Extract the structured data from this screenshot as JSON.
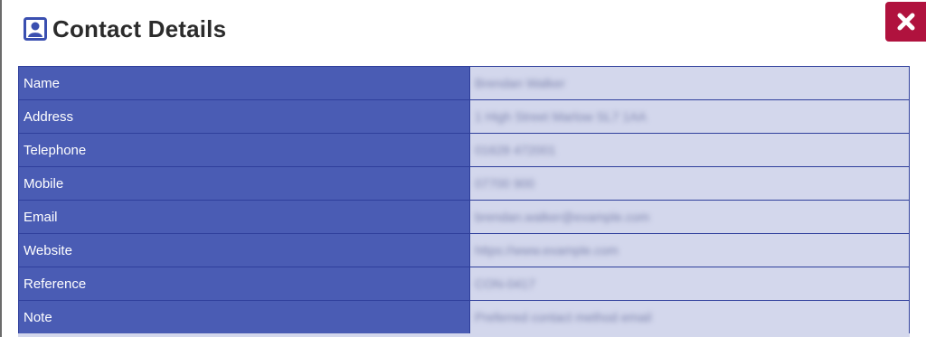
{
  "dialog": {
    "title": "Contact Details",
    "icon": "contact-card-icon",
    "close_icon": "close-icon",
    "accent_color": "#b0123e",
    "label_bg": "#4a5cb4",
    "value_bg": "#d3d7ec"
  },
  "rows": [
    {
      "label": "Name",
      "value": "Brendan Walker"
    },
    {
      "label": "Address",
      "value": "1 High Street Marlow SL7 1AA"
    },
    {
      "label": "Telephone",
      "value": "01628 472001"
    },
    {
      "label": "Mobile",
      "value": "07700 900"
    },
    {
      "label": "Email",
      "value": "brendan.walker@example.com"
    },
    {
      "label": "Website",
      "value": "https://www.example.com"
    },
    {
      "label": "Reference",
      "value": "CON-0417"
    },
    {
      "label": "Note",
      "value": "Preferred contact method email"
    }
  ]
}
